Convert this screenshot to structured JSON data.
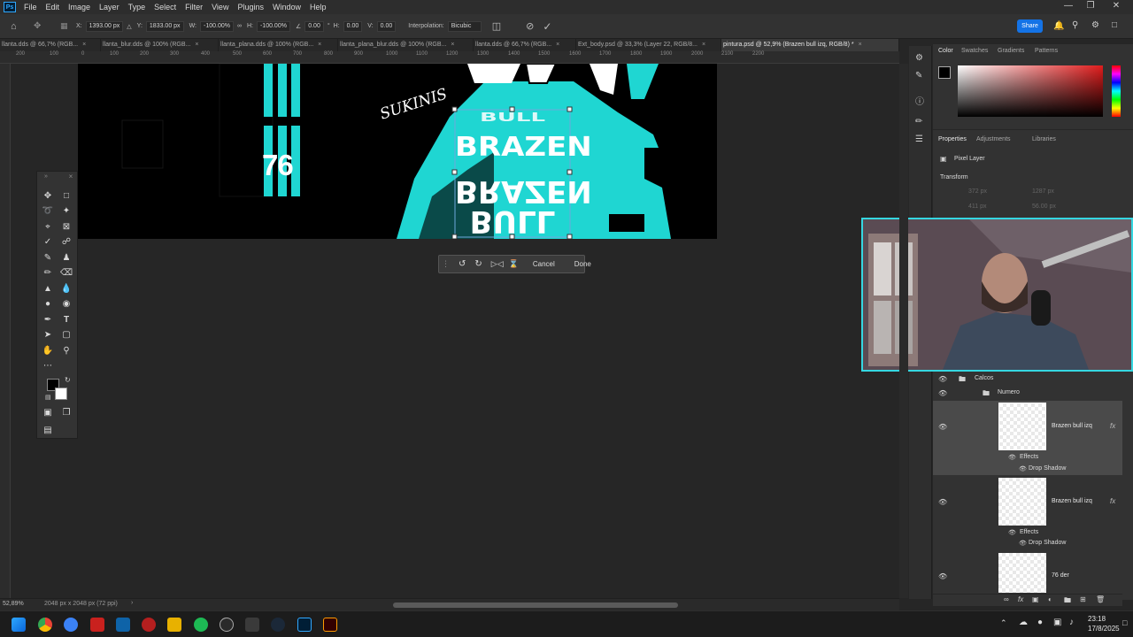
{
  "menubar": {
    "app_icon": "Ps",
    "items": [
      "File",
      "Edit",
      "Image",
      "Layer",
      "Type",
      "Select",
      "Filter",
      "View",
      "Plugins",
      "Window",
      "Help"
    ]
  },
  "options_bar": {
    "x_label": "X:",
    "x_value": "1393.00 px",
    "y_label": "Y:",
    "y_value": "1833.00 px",
    "w_label": "W:",
    "w_value": "-100.00%",
    "h_label": "H:",
    "h_value": "-100.00%",
    "angle_value": "0.00",
    "hskew_label": "H:",
    "hskew_value": "0.00",
    "vskew_label": "V:",
    "vskew_value": "0.00",
    "interpolation_label": "Interpolation:",
    "interpolation_value": "Bicubic",
    "share_label": "Share"
  },
  "tabs": [
    {
      "label": "llanta.dds @ 66,7% (RGB...",
      "active": false
    },
    {
      "label": "llanta_blur.dds @ 100% (RGB...",
      "active": false
    },
    {
      "label": "llanta_plana.dds @ 100% (RGB...",
      "active": false
    },
    {
      "label": "llanta_plana_blur.dds @ 100% (RGB...",
      "active": false
    },
    {
      "label": "llanta.dds @ 66,7% (RGB...",
      "active": false
    },
    {
      "label": "Ext_body.psd @ 33,3% (Layer 22, RGB/8...",
      "active": false
    },
    {
      "label": "pintura.psd @ 52,9% (Brazen bull izq, RGB/8) *",
      "active": true
    }
  ],
  "ruler_ticks": [
    "200",
    "100",
    "0",
    "100",
    "200",
    "300",
    "400",
    "500",
    "600",
    "700",
    "800",
    "900",
    "1000",
    "1100",
    "1200",
    "1300",
    "1400",
    "1500",
    "1600",
    "1700",
    "1800",
    "1900",
    "2000",
    "2100",
    "2200"
  ],
  "canvas_text": {
    "number": "76",
    "signature": "SUKINIS",
    "brazen_top": "BRAZEN",
    "bull_top": "BULL",
    "brazen_flipped": "BRAZEN",
    "bull_flipped": "BULL"
  },
  "transform_bar": {
    "cancel_label": "Cancel",
    "done_label": "Done"
  },
  "status_bar": {
    "zoom": "52,89%",
    "doc_info": "2048 px x 2048 px (72 ppi)"
  },
  "panel_tabs_top": [
    "Color",
    "Swatches",
    "Gradients",
    "Patterns"
  ],
  "panel_tabs_mid": [
    "Properties",
    "Adjustments",
    "Libraries"
  ],
  "properties": {
    "kind": "Pixel Layer",
    "section": "Transform",
    "w_value": "372 px",
    "h_value": "1287 px",
    "x_value": "411 px",
    "y_value": "56.00 px"
  },
  "layers": {
    "group1": "Calcos",
    "group2": "Numero",
    "rows": [
      {
        "name": "Brazen bull izq",
        "fx": "fx",
        "effects": "Effects",
        "effect": "Drop Shadow",
        "selected": true
      },
      {
        "name": "Brazen bull izq",
        "fx": "fx",
        "effects": "Effects",
        "effect": "Drop Shadow",
        "selected": false
      },
      {
        "name": "76 der",
        "fx": "",
        "effects": "",
        "effect": "",
        "selected": false
      }
    ]
  },
  "taskbar": {
    "time": "23:18",
    "date": "17/8/2025"
  },
  "colors": {
    "accent_teal": "#1fd6d2",
    "ps_blue": "#31a8ff",
    "share_blue": "#1473e6",
    "fg_color": "#000000",
    "bg_color": "#ffffff"
  }
}
